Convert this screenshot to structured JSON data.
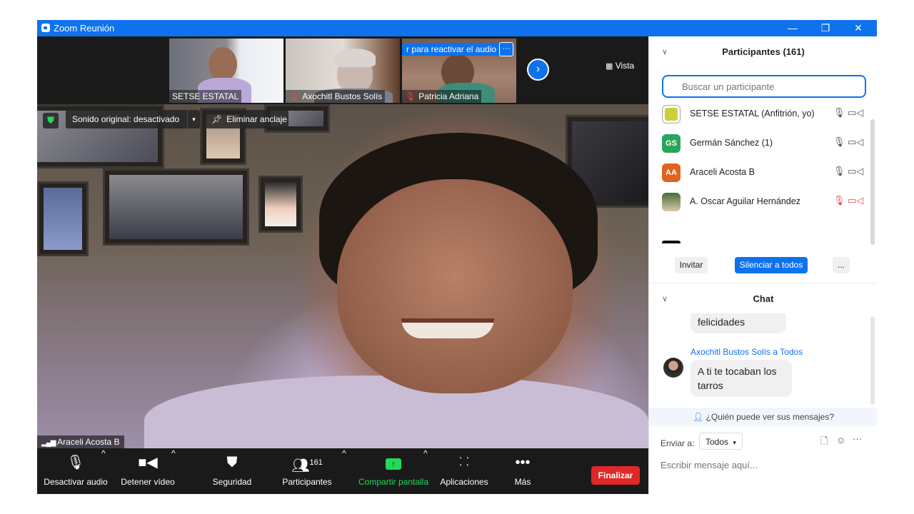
{
  "window": {
    "title": "Zoom Reunión",
    "minimize": "—",
    "restore": "❐",
    "close": "✕"
  },
  "strip": {
    "thumbs": [
      {
        "name": "SETSE ESTATAL",
        "muted": false
      },
      {
        "name": "Axochitl Bustos Solís",
        "muted": true
      },
      {
        "name": "Patricia Adriana",
        "muted": true
      }
    ],
    "unmute_banner": "r para reactivar el audio",
    "banner_more": "···",
    "next": "›",
    "view_label": "Vista"
  },
  "main": {
    "original_sound": "Sonido original: desactivado",
    "unpin": "Eliminar anclaje",
    "speaker_name": "Araceli Acosta B"
  },
  "toolbar": {
    "audio": "Desactivar audio",
    "video": "Detener vídeo",
    "security": "Seguridad",
    "participants": "Participantes",
    "participants_count": "161",
    "share": "Compartir pantalla",
    "apps": "Aplicaciones",
    "more": "Más",
    "end": "Finalizar"
  },
  "participants": {
    "header": "Participantes (161)",
    "search_placeholder": "Buscar un participante",
    "list": [
      {
        "name": "SETSE ESTATAL (Anfitrión, yo)",
        "initials": "",
        "color": "#c9d23a",
        "muted": false
      },
      {
        "name": "Germán Sánchez (1)",
        "initials": "GS",
        "color": "#26a65b",
        "muted": false
      },
      {
        "name": "Araceli Acosta B",
        "initials": "AA",
        "color": "#e0641d",
        "muted": false
      },
      {
        "name": "A. Oscar Aguilar Hernández",
        "initials": "",
        "color": "#7a8a4a",
        "muted": true
      }
    ],
    "invite": "Invitar",
    "mute_all": "Silenciar a todos",
    "more": "..."
  },
  "chat": {
    "header": "Chat",
    "prev_message": "felicidades",
    "sender": "Axochitl Bustos Solís a Todos",
    "message": "A ti te tocaban los tarros",
    "who_can_see": "¿Quién puede ver sus mensajes?",
    "send_to_label": "Enviar a:",
    "send_to_value": "Todos",
    "input_placeholder": "Escribir mensaje aquí..."
  },
  "colors": {
    "accent": "#0e72ed",
    "end": "#e02828",
    "share": "#23d959",
    "muted": "#e5484d"
  }
}
